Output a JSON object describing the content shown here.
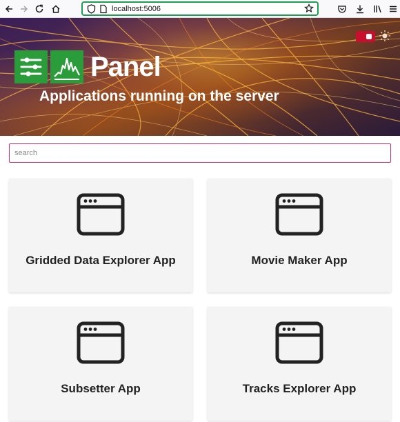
{
  "browser": {
    "url": "localhost:5006",
    "icons": [
      "back-icon",
      "forward-icon",
      "reload-icon",
      "home-icon",
      "shield-icon",
      "page-icon",
      "star-icon",
      "pocket-icon",
      "download-icon",
      "library-icon",
      "menu-icon"
    ]
  },
  "header": {
    "logo_text": "Panel",
    "subtitle": "Applications running on the server",
    "accent": "#c8102e",
    "logo_green": "#2a9d3a"
  },
  "search": {
    "placeholder": "search",
    "value": ""
  },
  "apps": [
    {
      "title": "Gridded Data Explorer App",
      "icon": "app-window-icon"
    },
    {
      "title": "Movie Maker App",
      "icon": "app-window-icon"
    },
    {
      "title": "Subsetter App",
      "icon": "app-window-icon"
    },
    {
      "title": "Tracks Explorer App",
      "icon": "app-window-icon"
    }
  ]
}
